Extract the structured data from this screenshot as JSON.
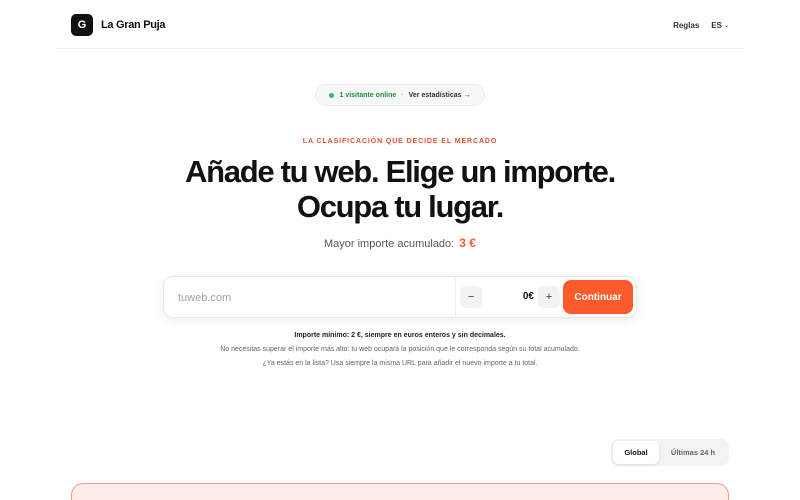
{
  "header": {
    "logo_letter": "G",
    "brand_name": "La Gran Puja",
    "nav_rules": "Reglas",
    "lang": "ES"
  },
  "status": {
    "online_text": "1 visitante online",
    "separator": "·",
    "stats_link": "Ver estadísticas →"
  },
  "hero": {
    "eyebrow": "LA CLASIFICACIÓN QUE DECIDE EL MERCADO",
    "headline_line1": "Añade tu web. Elige un importe.",
    "headline_line2": "Ocupa tu lugar.",
    "sub_label": "Mayor importe acumulado:",
    "sub_amount": "3 €"
  },
  "form": {
    "url_placeholder": "tuweb.com",
    "url_value": "",
    "minus_label": "−",
    "amount_value": "0€",
    "plus_label": "+",
    "submit_label": "Continuar"
  },
  "notes": {
    "line1": "Importe mínimo: 2 €, siempre en euros enteros y sin decimales.",
    "line2": "No necesitas superar el importe más alto: tu web ocupará la posición que le corresponda según su total acumulado.",
    "line3": "¿Ya estás en la lista? Usa siempre la misma URL para añadir el nuevo importe a tu total."
  },
  "ranking_tabs": [
    {
      "label": "Global",
      "active": true
    },
    {
      "label": "Últimas 24 h",
      "active": false
    }
  ],
  "colors": {
    "accent": "#ff5a2c",
    "online_dot": "#27c15a",
    "card_bg": "#fdecea",
    "card_border": "#f29b88"
  }
}
